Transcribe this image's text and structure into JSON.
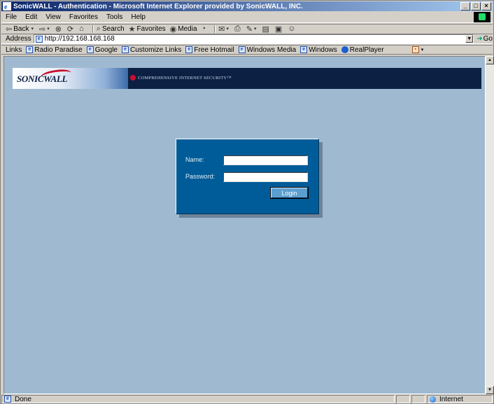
{
  "window": {
    "title": "SonicWALL - Authentication - Microsoft Internet Explorer provided by SonicWALL, INC."
  },
  "menu": [
    "File",
    "Edit",
    "View",
    "Favorites",
    "Tools",
    "Help"
  ],
  "toolbar": {
    "back": "Back",
    "search": "Search",
    "favorites": "Favorites",
    "media": "Media"
  },
  "address": {
    "label": "Address",
    "url": "http://192.168.168.168",
    "go": "Go"
  },
  "links": {
    "label": "Links",
    "items": [
      "Radio Paradise",
      "Google",
      "Customize Links",
      "Free Hotmail",
      "Windows Media",
      "Windows",
      "RealPlayer"
    ]
  },
  "banner": {
    "logo": "SONICWALL",
    "tagline": "COMPREHENSIVE INTERNET SECURITY™"
  },
  "login": {
    "name_label": "Name:",
    "name_value": "",
    "password_label": "Password:",
    "password_value": "",
    "submit_label": "Login"
  },
  "status": {
    "text": "Done",
    "zone": "Internet"
  },
  "colors": {
    "page_background": "#9fbad0",
    "panel": "#005c99",
    "banner": "#0c2044",
    "button": "#5b9fd1",
    "brand_red": "#c8102e"
  }
}
